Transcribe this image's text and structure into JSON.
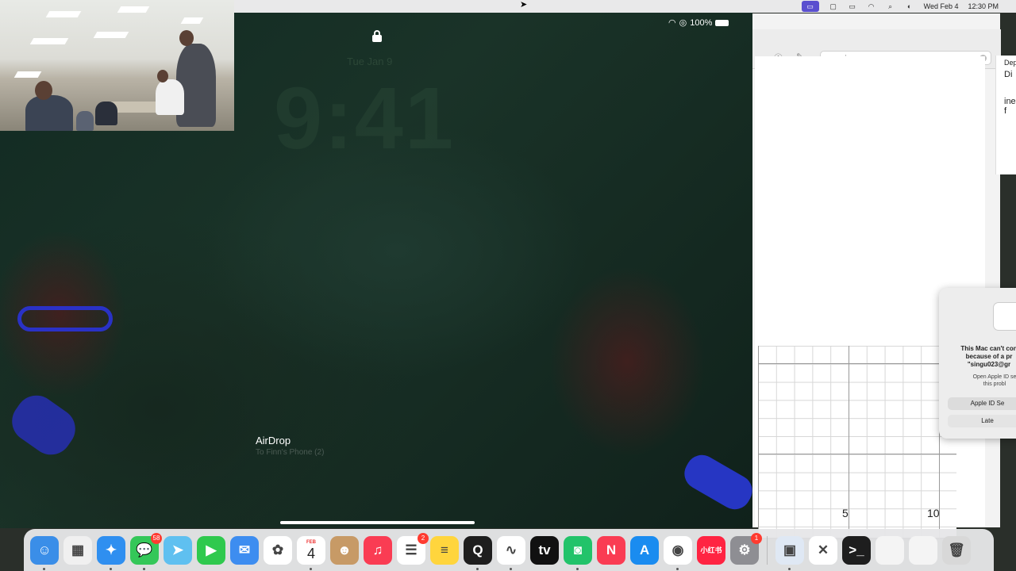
{
  "menubar": {
    "date": "Wed Feb 4",
    "time": "12:30 PM"
  },
  "notes_app": {
    "search_value": "conic",
    "axis_ticks": [
      "5",
      "10"
    ],
    "side_doc_lines": [
      "Dept.",
      "Di",
      "ine f"
    ]
  },
  "dialog": {
    "title": "This Mac can't con\nbecause of a pr\n\"singu023@gr",
    "subtitle": "Open Apple ID se\nthis probl",
    "primary_button": "Apple ID Se",
    "secondary_button": "Late"
  },
  "ipad": {
    "battery": "100%",
    "lock_date": "Tue Jan 9",
    "lock_time": "9:41",
    "airdrop_title": "AirDrop",
    "airdrop_sub": "To Finn's Phone (2)"
  },
  "dock": {
    "apps": [
      {
        "name": "finder",
        "glyph": "☺",
        "color": "#3a8ee8",
        "badge": "",
        "running": true
      },
      {
        "name": "launchpad",
        "glyph": "▦",
        "color": "#f0f0f0",
        "badge": "",
        "running": false
      },
      {
        "name": "safari",
        "glyph": "✦",
        "color": "#2f8ff0",
        "badge": "",
        "running": true
      },
      {
        "name": "messages",
        "glyph": "💬",
        "color": "#34c759",
        "badge": "58",
        "running": true
      },
      {
        "name": "maps",
        "glyph": "➤",
        "color": "#5fc0f0",
        "badge": "",
        "running": false
      },
      {
        "name": "facetime",
        "glyph": "▶",
        "color": "#2fc94e",
        "badge": "",
        "running": false
      },
      {
        "name": "mail",
        "glyph": "✉",
        "color": "#3d8df0",
        "badge": "",
        "running": false
      },
      {
        "name": "photos",
        "glyph": "✿",
        "color": "#ffffff",
        "badge": "",
        "running": false
      },
      {
        "name": "calendar",
        "glyph": "",
        "color": "#ffffff",
        "badge": "",
        "running": true
      },
      {
        "name": "contacts",
        "glyph": "☻",
        "color": "#c79a66",
        "badge": "",
        "running": false
      },
      {
        "name": "music",
        "glyph": "♫",
        "color": "#fa3c53",
        "badge": "",
        "running": false
      },
      {
        "name": "reminders",
        "glyph": "☰",
        "color": "#ffffff",
        "badge": "2",
        "running": false
      },
      {
        "name": "notes",
        "glyph": "≡",
        "color": "#ffd53d",
        "badge": "",
        "running": false
      },
      {
        "name": "quicktime",
        "glyph": "Q",
        "color": "#1e1e1e",
        "badge": "",
        "running": true
      },
      {
        "name": "freeform",
        "glyph": "∿",
        "color": "#ffffff",
        "badge": "",
        "running": true
      },
      {
        "name": "apple-tv",
        "glyph": "tv",
        "color": "#111111",
        "badge": "",
        "running": false
      },
      {
        "name": "chat-app",
        "glyph": "◙",
        "color": "#22c36a",
        "badge": "",
        "running": true
      },
      {
        "name": "news",
        "glyph": "N",
        "color": "#fa3c53",
        "badge": "",
        "running": false
      },
      {
        "name": "app-store",
        "glyph": "A",
        "color": "#1a8cf0",
        "badge": "",
        "running": false
      },
      {
        "name": "chrome",
        "glyph": "◉",
        "color": "#ffffff",
        "badge": "",
        "running": true
      },
      {
        "name": "xiaohongshu",
        "glyph": "小红书",
        "color": "#ff2442",
        "badge": "",
        "running": false
      },
      {
        "name": "system-settings",
        "glyph": "⚙",
        "color": "#8e8e93",
        "badge": "1",
        "running": false
      }
    ],
    "calendar_month": "FEB",
    "calendar_day": "4",
    "right_apps": [
      {
        "name": "preview",
        "glyph": "▣",
        "color": "#dfe8f4",
        "running": true
      },
      {
        "name": "xcode-tool",
        "glyph": "✕",
        "color": "#ffffff",
        "running": false
      },
      {
        "name": "terminal",
        "glyph": ">_",
        "color": "#1e1e1e",
        "running": false
      },
      {
        "name": "document",
        "glyph": "",
        "color": "#f4f4f4",
        "running": false
      },
      {
        "name": "calendar-file",
        "glyph": "",
        "color": "#f4f4f4",
        "running": false
      },
      {
        "name": "trash",
        "glyph": "🗑",
        "color": "#d8d8d8",
        "running": false
      }
    ]
  }
}
